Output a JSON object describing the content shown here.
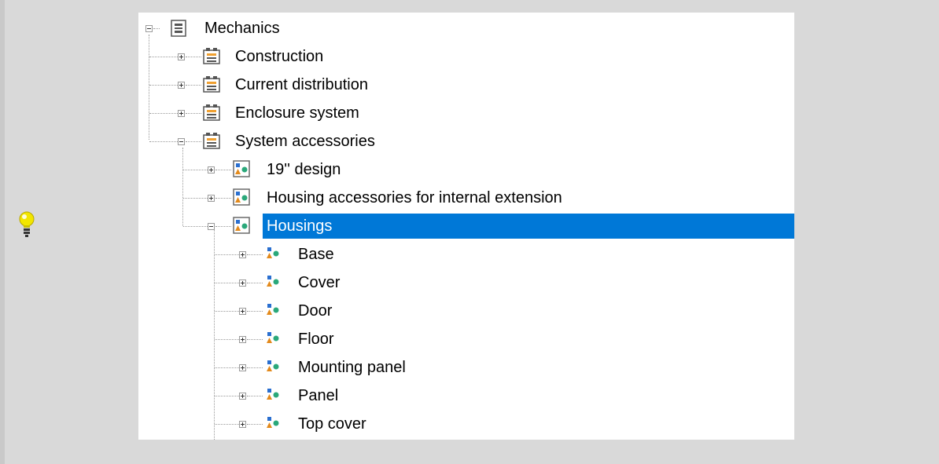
{
  "tree": {
    "root": {
      "label": "Mechanics",
      "icon": "catalog-root-icon",
      "expanded": true
    },
    "groups": [
      {
        "label": "Construction",
        "icon": "folder-group-icon",
        "expanded": false
      },
      {
        "label": "Current distribution",
        "icon": "folder-group-icon",
        "expanded": false
      },
      {
        "label": "Enclosure system",
        "icon": "folder-group-icon",
        "expanded": false
      },
      {
        "label": "System accessories",
        "icon": "folder-group-icon",
        "expanded": true
      }
    ],
    "subgroups": [
      {
        "label": "19'' design",
        "icon": "product-group-icon",
        "expanded": false
      },
      {
        "label": "Housing accessories for internal extension",
        "icon": "product-group-icon",
        "expanded": false
      },
      {
        "label": "Housings",
        "icon": "product-group-icon",
        "expanded": true,
        "selected": true
      }
    ],
    "items": [
      {
        "label": "Base",
        "icon": "product-icon"
      },
      {
        "label": "Cover",
        "icon": "product-icon"
      },
      {
        "label": "Door",
        "icon": "product-icon"
      },
      {
        "label": "Floor",
        "icon": "product-icon"
      },
      {
        "label": "Mounting panel",
        "icon": "product-icon"
      },
      {
        "label": "Panel",
        "icon": "product-icon"
      },
      {
        "label": "Top cover",
        "icon": "product-icon"
      }
    ]
  },
  "hint": {
    "icon": "lightbulb-icon"
  },
  "colors": {
    "selection": "#0078d7",
    "background": "#d9d9d9",
    "panel": "#ffffff"
  }
}
